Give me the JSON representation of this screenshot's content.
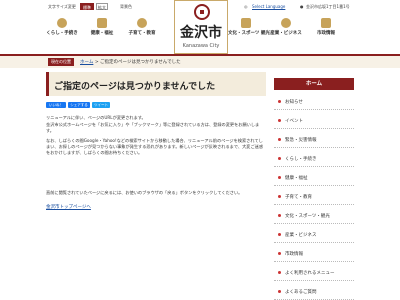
{
  "topbar": {
    "font_size": "文字サイズ変更",
    "standard": "標準",
    "large": "拡大",
    "color_label": "背景色",
    "select_language": "Select Language",
    "address": "金沢市広坂1丁目1番1号"
  },
  "logo": {
    "name": "金沢市",
    "english": "Kanazawa City"
  },
  "nav": {
    "items": [
      {
        "label": "くらし・手続き"
      },
      {
        "label": "健康・福祉"
      },
      {
        "label": "子育て・教育"
      },
      {
        "label": "文化・スポーツ 観光"
      },
      {
        "label": "産業・ビジネス"
      },
      {
        "label": "市政情報"
      }
    ]
  },
  "breadcrumb": {
    "badge": "現在の位置",
    "home": "ホーム",
    "separator": ">",
    "current": "ご指定のページは見つかりませんでした"
  },
  "main": {
    "title": "ご指定のページは見つかりませんでした",
    "social": {
      "like": "いいね！",
      "share": "シェアする",
      "tweet": "ツイート"
    },
    "paragraphs": [
      "リニューアルに伴い、ページのURLが変更されます。",
      "金沢市公式ホームページを「お気に入り」や「ブックマーク」等に登録されている方は、登録の変更をお願いします。",
      "なお、しばらくの間Google・Yahoo!などの検索サイトから移動した場合、リニューアル前のページを検索されてしまい、お探しのページが見つからない事象が発生する恐れがあります。新しいページが反映されるまで、大変ご迷惑をおかけしますが、しばらくの間お待ちください。",
      "直前に閲覧されていたページに戻るには、お使いのブラウザの「戻る」ボタンをクリックしてください。"
    ],
    "top_link": "金沢市トップページへ"
  },
  "sidebar": {
    "head": "ホーム",
    "items": [
      {
        "label": "お知らせ"
      },
      {
        "label": "イベント"
      },
      {
        "label": "緊急・災害情報"
      },
      {
        "label": "くらし・手続き"
      },
      {
        "label": "健康・福祉"
      },
      {
        "label": "子育て・教育"
      },
      {
        "label": "文化・スポーツ・観光"
      },
      {
        "label": "産業・ビジネス"
      },
      {
        "label": "市政情報"
      },
      {
        "label": "よく利用されるメニュー"
      },
      {
        "label": "よくあるご質問"
      }
    ]
  },
  "colors": {
    "accent": "#8a1f1f",
    "gold": "#c7a35a",
    "breadcrumb_bg": "#f7f1e6",
    "link": "#1a4fa0"
  }
}
